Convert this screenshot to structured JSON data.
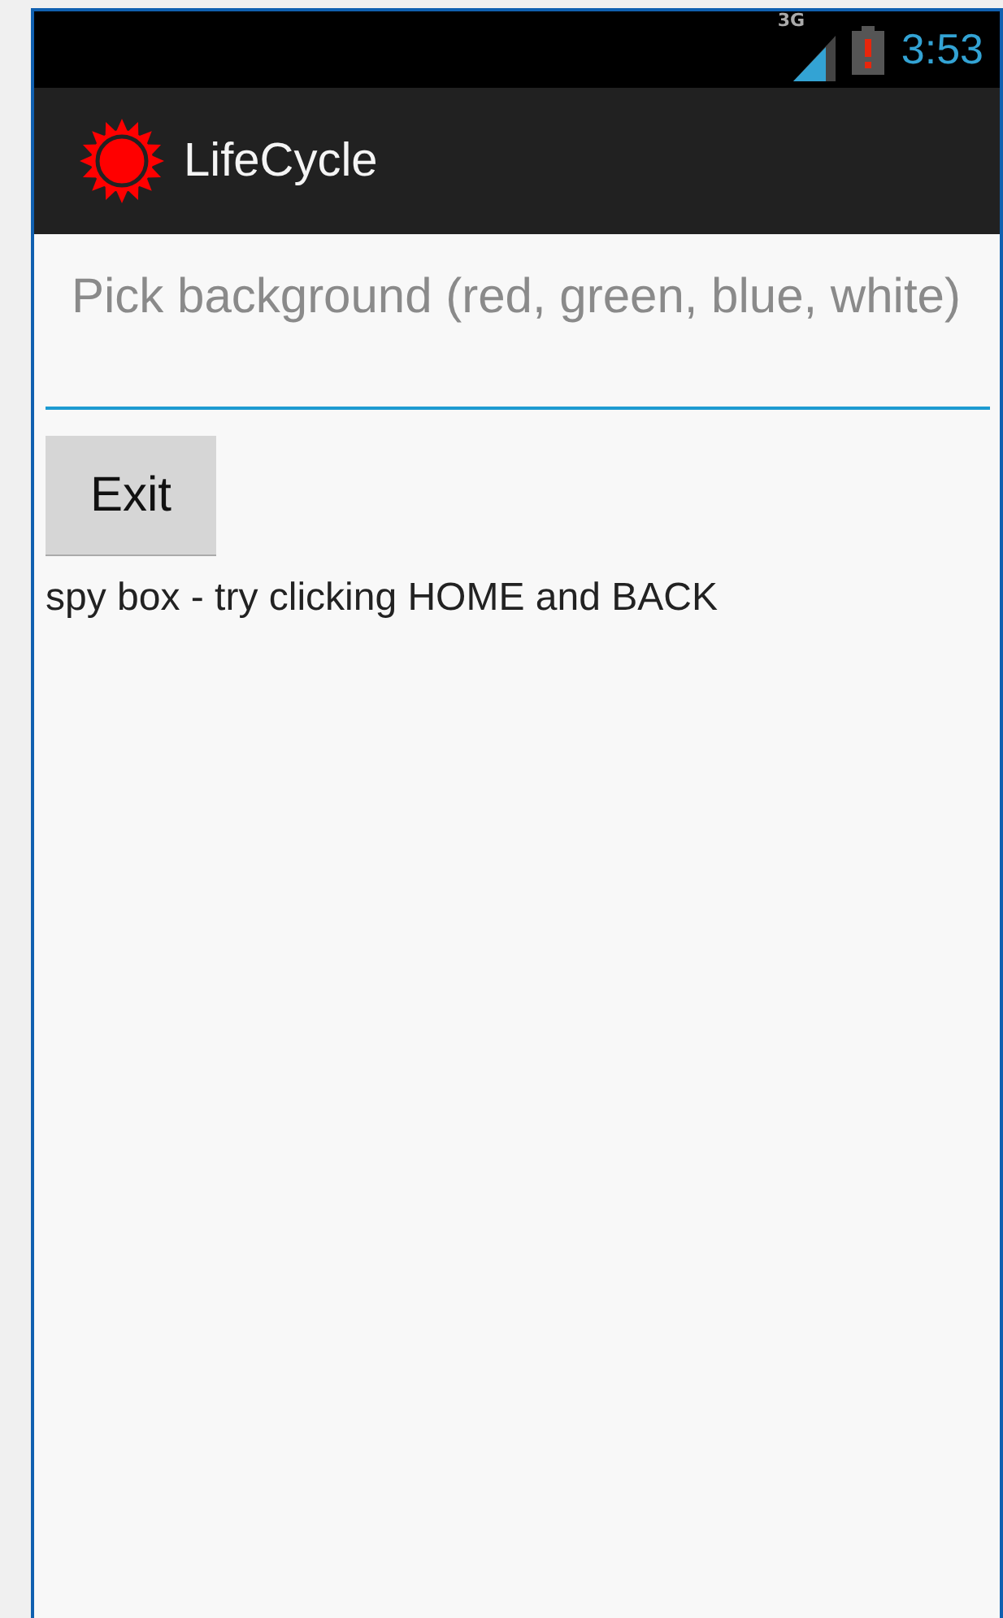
{
  "status_bar": {
    "network_type": "3G",
    "time": "3:53"
  },
  "action_bar": {
    "title": "LifeCycle"
  },
  "background_field": {
    "placeholder": "Pick background (red, green, blue, white)"
  },
  "buttons": [
    {
      "label": "Exit"
    }
  ],
  "spy_box": "spy box - try clicking HOME and BACK"
}
